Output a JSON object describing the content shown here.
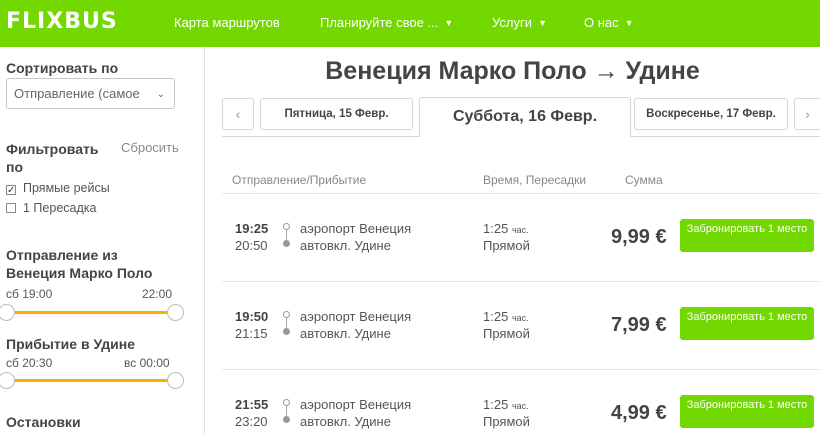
{
  "header": {
    "logo": "FLIXBUS",
    "nav": [
      {
        "label": "Карта маршрутов"
      },
      {
        "label": "Планируйте свое ..."
      },
      {
        "label": "Услуги"
      },
      {
        "label": "О нас"
      }
    ]
  },
  "sidebar": {
    "sort_label": "Сортировать по",
    "sort_value": "Отправление (самое",
    "filter_label": "Фильтровать по",
    "reset_label": "Сбросить",
    "filters": [
      {
        "label": "Прямые рейсы",
        "checked": true
      },
      {
        "label": "1 Пересадка",
        "checked": false
      }
    ],
    "departure": {
      "label": "Отправление из Венеция Марко Поло",
      "min": "сб 19:00",
      "max": "22:00"
    },
    "arrival": {
      "label": "Прибытие в Удине",
      "min": "сб 20:30",
      "max": "вс 00:00"
    },
    "stops_label": "Остановки"
  },
  "main": {
    "title": "Венеция Марко Поло → Удине",
    "prev_arrow": "‹",
    "next_arrow": "›",
    "dates": [
      {
        "label": "Пятница, 15 Февр.",
        "active": false
      },
      {
        "label": "Суббота, 16 Февр.",
        "active": true
      },
      {
        "label": "Воскресенье, 17 Февр.",
        "active": false
      }
    ],
    "columns": {
      "route": "Отправление/Прибытие",
      "time": "Время, Пересадки",
      "price": "Сумма"
    },
    "rides": [
      {
        "dep_time": "19:25",
        "arr_time": "20:50",
        "from": "аэропорт Венеция",
        "to": "автовкл. Удине",
        "duration": "1:25",
        "duration_unit": "час.",
        "transfer": "Прямой",
        "price": "9,99 €",
        "book": "Забронировать 1 место"
      },
      {
        "dep_time": "19:50",
        "arr_time": "21:15",
        "from": "аэропорт Венеция",
        "to": "автовкл. Удине",
        "duration": "1:25",
        "duration_unit": "час.",
        "transfer": "Прямой",
        "price": "7,99 €",
        "book": "Забронировать 1 место"
      },
      {
        "dep_time": "21:55",
        "arr_time": "23:20",
        "from": "аэропорт Венеция",
        "to": "автовкл. Удине",
        "duration": "1:25",
        "duration_unit": "час.",
        "transfer": "Прямой",
        "price": "4,99 €",
        "book": "Забронировать 1 место"
      }
    ]
  },
  "colors": {
    "brand_green": "#73d700",
    "slider_orange": "#ffad00"
  },
  "icons": {
    "nav_dropdown": "chevron-down-icon",
    "checkbox_checked": "check-icon"
  }
}
